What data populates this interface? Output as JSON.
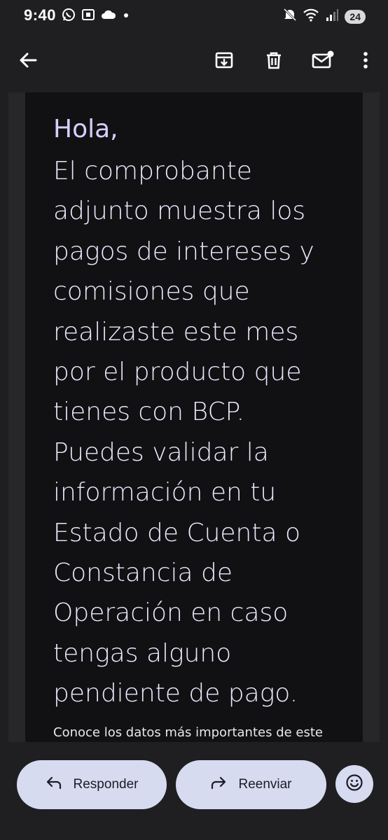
{
  "status_bar": {
    "time": "9:40",
    "battery": "24",
    "left_icons": [
      "whatsapp-icon",
      "screenshot-icon",
      "cloud-icon",
      "dot-icon"
    ],
    "right_icons": [
      "mute-icon",
      "wifi-icon",
      "signal-icon"
    ]
  },
  "app_bar": {
    "icons": [
      "back-arrow-icon",
      "archive-icon",
      "delete-icon",
      "mark-unread-icon",
      "more-vert-icon"
    ]
  },
  "message": {
    "greeting": "Hola,",
    "body_lines": [
      "El comprobante",
      "adjunto muestra los",
      "pagos de intereses y",
      "comisiones que",
      "realizaste este mes",
      "por el producto que",
      "tienes con BCP.",
      "Puedes validar la",
      "información en tu",
      "Estado de Cuenta o",
      "Constancia de",
      "Operación en caso",
      "tengas alguno",
      "pendiente de pago."
    ],
    "footer_text": "Conoce los datos más importantes de este"
  },
  "actions": {
    "reply_label": "Responder",
    "forward_label": "Reenviar",
    "emoji_icon": "emoji-smile-icon"
  },
  "colors": {
    "background": "#1f1f22",
    "card": "#111113",
    "text_accent": "#d4d0ff",
    "pill": "#d7dbf0"
  }
}
